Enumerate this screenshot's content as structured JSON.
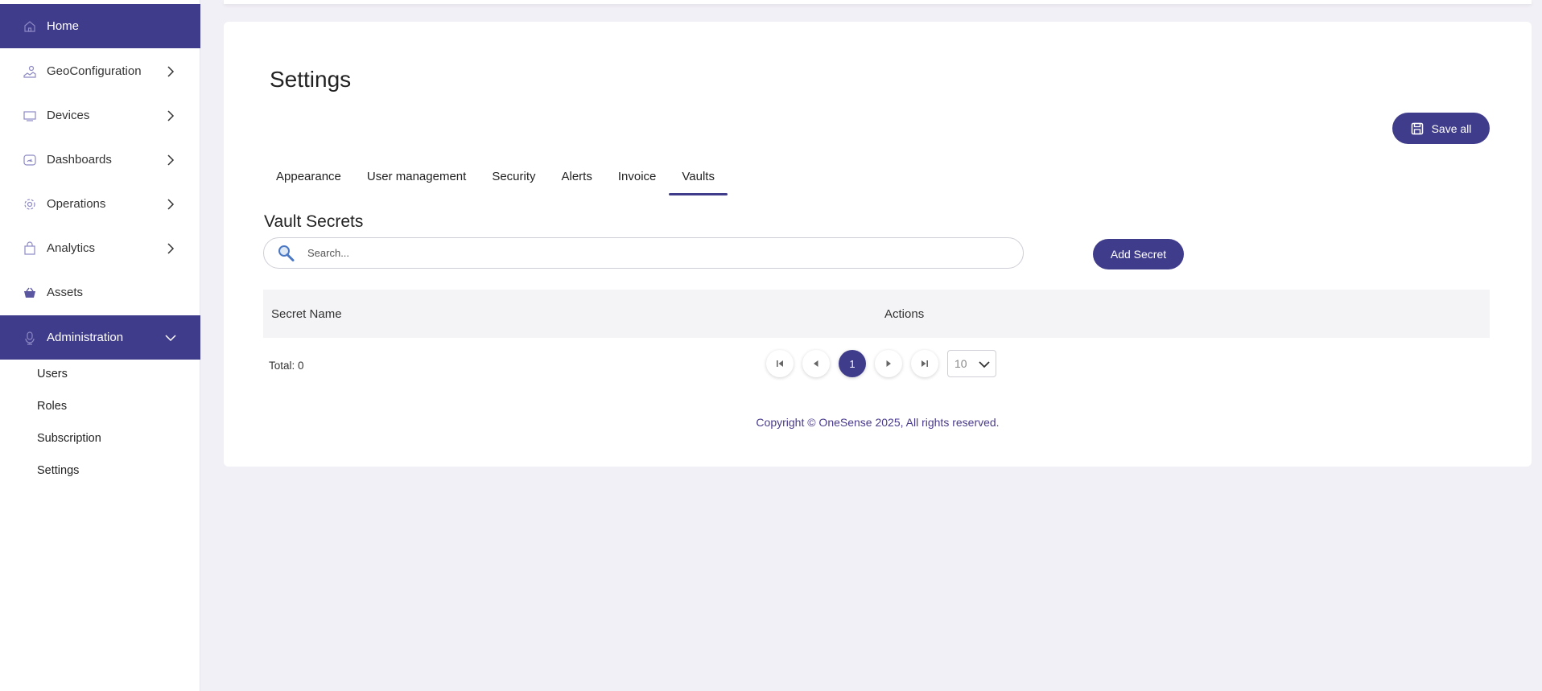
{
  "sidebar": {
    "items": [
      {
        "label": "Home",
        "icon": "home-icon",
        "active": true,
        "expandable": false
      },
      {
        "label": "GeoConfiguration",
        "icon": "map-icon",
        "active": false,
        "expandable": true
      },
      {
        "label": "Devices",
        "icon": "monitor-icon",
        "active": false,
        "expandable": true
      },
      {
        "label": "Dashboards",
        "icon": "gauge-icon",
        "active": false,
        "expandable": true
      },
      {
        "label": "Operations",
        "icon": "gear-icon",
        "active": false,
        "expandable": true
      },
      {
        "label": "Analytics",
        "icon": "bag-icon",
        "active": false,
        "expandable": true
      },
      {
        "label": "Assets",
        "icon": "basket-icon",
        "active": false,
        "expandable": false
      },
      {
        "label": "Administration",
        "icon": "admin-icon",
        "active": true,
        "expandable": true,
        "expanded": true
      }
    ],
    "sub_items": [
      "Users",
      "Roles",
      "Subscription",
      "Settings"
    ]
  },
  "main": {
    "title": "Settings",
    "save_label": "Save all",
    "tabs": [
      "Appearance",
      "User management",
      "Security",
      "Alerts",
      "Invoice",
      "Vaults"
    ],
    "active_tab": "Vaults",
    "section_title": "Vault Secrets",
    "search_placeholder": "Search...",
    "add_label": "Add Secret",
    "table": {
      "columns": [
        "Secret Name",
        "Actions"
      ],
      "rows": []
    },
    "total_label": "Total: 0",
    "pagination": {
      "current_page": "1",
      "page_size": "10"
    },
    "copyright": "Copyright © OneSense 2025, All rights reserved."
  },
  "colors": {
    "accent": "#403c8c",
    "background": "#f1f0f6",
    "card": "#ffffff",
    "footer_text": "#4a3a8c"
  }
}
